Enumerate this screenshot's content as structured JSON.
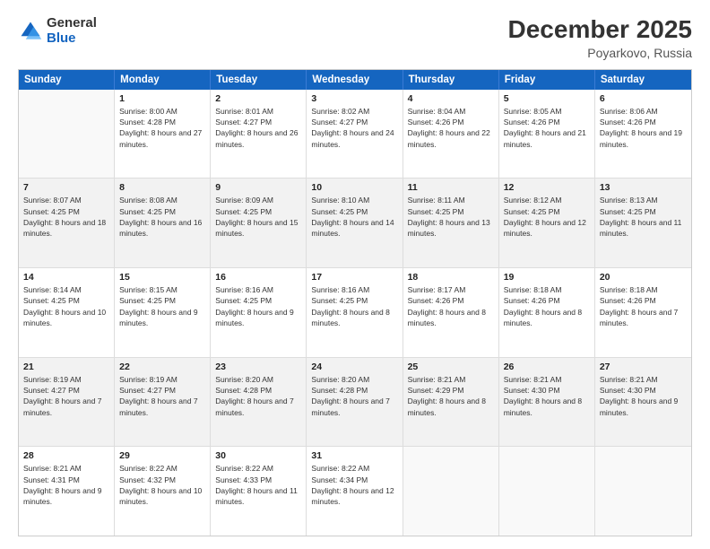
{
  "logo": {
    "general": "General",
    "blue": "Blue"
  },
  "title": "December 2025",
  "location": "Poyarkovo, Russia",
  "days_of_week": [
    "Sunday",
    "Monday",
    "Tuesday",
    "Wednesday",
    "Thursday",
    "Friday",
    "Saturday"
  ],
  "weeks": [
    [
      {
        "day": "",
        "sunrise": "",
        "sunset": "",
        "daylight": ""
      },
      {
        "day": "1",
        "sunrise": "Sunrise: 8:00 AM",
        "sunset": "Sunset: 4:28 PM",
        "daylight": "Daylight: 8 hours and 27 minutes."
      },
      {
        "day": "2",
        "sunrise": "Sunrise: 8:01 AM",
        "sunset": "Sunset: 4:27 PM",
        "daylight": "Daylight: 8 hours and 26 minutes."
      },
      {
        "day": "3",
        "sunrise": "Sunrise: 8:02 AM",
        "sunset": "Sunset: 4:27 PM",
        "daylight": "Daylight: 8 hours and 24 minutes."
      },
      {
        "day": "4",
        "sunrise": "Sunrise: 8:04 AM",
        "sunset": "Sunset: 4:26 PM",
        "daylight": "Daylight: 8 hours and 22 minutes."
      },
      {
        "day": "5",
        "sunrise": "Sunrise: 8:05 AM",
        "sunset": "Sunset: 4:26 PM",
        "daylight": "Daylight: 8 hours and 21 minutes."
      },
      {
        "day": "6",
        "sunrise": "Sunrise: 8:06 AM",
        "sunset": "Sunset: 4:26 PM",
        "daylight": "Daylight: 8 hours and 19 minutes."
      }
    ],
    [
      {
        "day": "7",
        "sunrise": "Sunrise: 8:07 AM",
        "sunset": "Sunset: 4:25 PM",
        "daylight": "Daylight: 8 hours and 18 minutes."
      },
      {
        "day": "8",
        "sunrise": "Sunrise: 8:08 AM",
        "sunset": "Sunset: 4:25 PM",
        "daylight": "Daylight: 8 hours and 16 minutes."
      },
      {
        "day": "9",
        "sunrise": "Sunrise: 8:09 AM",
        "sunset": "Sunset: 4:25 PM",
        "daylight": "Daylight: 8 hours and 15 minutes."
      },
      {
        "day": "10",
        "sunrise": "Sunrise: 8:10 AM",
        "sunset": "Sunset: 4:25 PM",
        "daylight": "Daylight: 8 hours and 14 minutes."
      },
      {
        "day": "11",
        "sunrise": "Sunrise: 8:11 AM",
        "sunset": "Sunset: 4:25 PM",
        "daylight": "Daylight: 8 hours and 13 minutes."
      },
      {
        "day": "12",
        "sunrise": "Sunrise: 8:12 AM",
        "sunset": "Sunset: 4:25 PM",
        "daylight": "Daylight: 8 hours and 12 minutes."
      },
      {
        "day": "13",
        "sunrise": "Sunrise: 8:13 AM",
        "sunset": "Sunset: 4:25 PM",
        "daylight": "Daylight: 8 hours and 11 minutes."
      }
    ],
    [
      {
        "day": "14",
        "sunrise": "Sunrise: 8:14 AM",
        "sunset": "Sunset: 4:25 PM",
        "daylight": "Daylight: 8 hours and 10 minutes."
      },
      {
        "day": "15",
        "sunrise": "Sunrise: 8:15 AM",
        "sunset": "Sunset: 4:25 PM",
        "daylight": "Daylight: 8 hours and 9 minutes."
      },
      {
        "day": "16",
        "sunrise": "Sunrise: 8:16 AM",
        "sunset": "Sunset: 4:25 PM",
        "daylight": "Daylight: 8 hours and 9 minutes."
      },
      {
        "day": "17",
        "sunrise": "Sunrise: 8:16 AM",
        "sunset": "Sunset: 4:25 PM",
        "daylight": "Daylight: 8 hours and 8 minutes."
      },
      {
        "day": "18",
        "sunrise": "Sunrise: 8:17 AM",
        "sunset": "Sunset: 4:26 PM",
        "daylight": "Daylight: 8 hours and 8 minutes."
      },
      {
        "day": "19",
        "sunrise": "Sunrise: 8:18 AM",
        "sunset": "Sunset: 4:26 PM",
        "daylight": "Daylight: 8 hours and 8 minutes."
      },
      {
        "day": "20",
        "sunrise": "Sunrise: 8:18 AM",
        "sunset": "Sunset: 4:26 PM",
        "daylight": "Daylight: 8 hours and 7 minutes."
      }
    ],
    [
      {
        "day": "21",
        "sunrise": "Sunrise: 8:19 AM",
        "sunset": "Sunset: 4:27 PM",
        "daylight": "Daylight: 8 hours and 7 minutes."
      },
      {
        "day": "22",
        "sunrise": "Sunrise: 8:19 AM",
        "sunset": "Sunset: 4:27 PM",
        "daylight": "Daylight: 8 hours and 7 minutes."
      },
      {
        "day": "23",
        "sunrise": "Sunrise: 8:20 AM",
        "sunset": "Sunset: 4:28 PM",
        "daylight": "Daylight: 8 hours and 7 minutes."
      },
      {
        "day": "24",
        "sunrise": "Sunrise: 8:20 AM",
        "sunset": "Sunset: 4:28 PM",
        "daylight": "Daylight: 8 hours and 7 minutes."
      },
      {
        "day": "25",
        "sunrise": "Sunrise: 8:21 AM",
        "sunset": "Sunset: 4:29 PM",
        "daylight": "Daylight: 8 hours and 8 minutes."
      },
      {
        "day": "26",
        "sunrise": "Sunrise: 8:21 AM",
        "sunset": "Sunset: 4:30 PM",
        "daylight": "Daylight: 8 hours and 8 minutes."
      },
      {
        "day": "27",
        "sunrise": "Sunrise: 8:21 AM",
        "sunset": "Sunset: 4:30 PM",
        "daylight": "Daylight: 8 hours and 9 minutes."
      }
    ],
    [
      {
        "day": "28",
        "sunrise": "Sunrise: 8:21 AM",
        "sunset": "Sunset: 4:31 PM",
        "daylight": "Daylight: 8 hours and 9 minutes."
      },
      {
        "day": "29",
        "sunrise": "Sunrise: 8:22 AM",
        "sunset": "Sunset: 4:32 PM",
        "daylight": "Daylight: 8 hours and 10 minutes."
      },
      {
        "day": "30",
        "sunrise": "Sunrise: 8:22 AM",
        "sunset": "Sunset: 4:33 PM",
        "daylight": "Daylight: 8 hours and 11 minutes."
      },
      {
        "day": "31",
        "sunrise": "Sunrise: 8:22 AM",
        "sunset": "Sunset: 4:34 PM",
        "daylight": "Daylight: 8 hours and 12 minutes."
      },
      {
        "day": "",
        "sunrise": "",
        "sunset": "",
        "daylight": ""
      },
      {
        "day": "",
        "sunrise": "",
        "sunset": "",
        "daylight": ""
      },
      {
        "day": "",
        "sunrise": "",
        "sunset": "",
        "daylight": ""
      }
    ]
  ]
}
